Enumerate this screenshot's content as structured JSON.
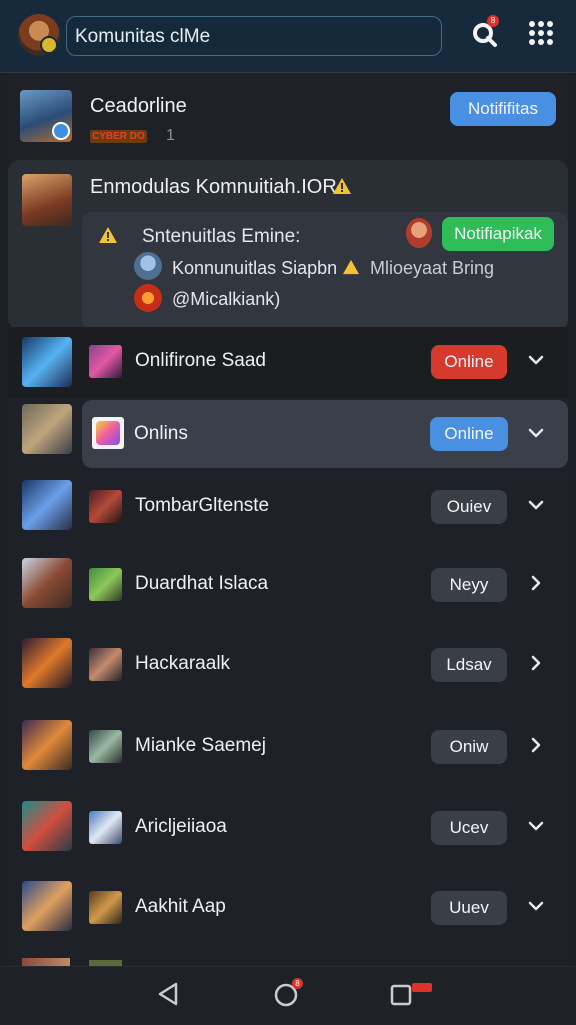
{
  "topbar": {
    "search_value": "Komunitas clMe",
    "notification_badge": "8"
  },
  "profile": {
    "name": "Ceadorline",
    "tag": "CYBER DO",
    "count": "1",
    "button_label": "Notififitas"
  },
  "community": {
    "title": "Enmodulas Komnuitiah.IOR",
    "subcard_title": "Sntenuitlas Emine:",
    "subcard_button": "Notifiapikak",
    "line1_name": "Konnunuitlas Siapbn",
    "line1_extra": "Mlioeyaat Bring",
    "line2_handle": "@Micalkiank)"
  },
  "rows": [
    {
      "name": "Onlifirone Saad",
      "status": "Online",
      "status_color": "#d63a2c",
      "chevron": "down"
    },
    {
      "name": "Onlins",
      "status": "Online",
      "status_color": "#4a90e2",
      "chevron": "down"
    },
    {
      "name": "TombarGltenste",
      "status": "Ouiev",
      "status_color": "#3a3e47",
      "chevron": "down"
    },
    {
      "name": "Duardhat Islaca",
      "status": "Neyy",
      "status_color": "#3a3e47",
      "chevron": "right"
    },
    {
      "name": "Hackaraalk",
      "status": "Ldsav",
      "status_color": "#3a3e47",
      "chevron": "right"
    },
    {
      "name": "Mianke Saemej",
      "status": "Oniw",
      "status_color": "#3a3e47",
      "chevron": "right"
    },
    {
      "name": "Aricljeiiaoa",
      "status": "Ucev",
      "status_color": "#3a3e47",
      "chevron": "down"
    },
    {
      "name": "Aakhit Aap",
      "status": "Uuev",
      "status_color": "#3a3e47",
      "chevron": "down"
    }
  ],
  "bottom_nav": {
    "home_badge": "8"
  },
  "colors": {
    "accent_blue": "#4a90e2",
    "accent_green": "#2ebd59",
    "accent_red": "#d63a2c",
    "bg": "#1d2026",
    "topbar": "#162a3b"
  }
}
